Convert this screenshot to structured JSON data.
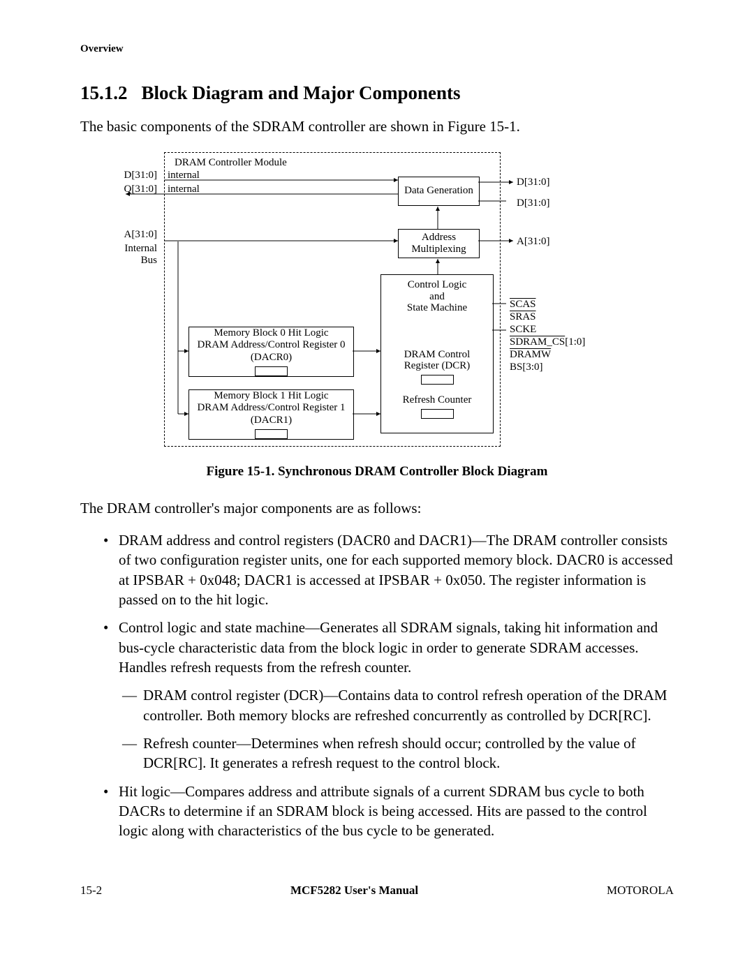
{
  "header": "Overview",
  "section_number": "15.1.2",
  "section_title": "Block Diagram and Major Components",
  "intro": "The basic components of the SDRAM controller are shown in Figure 15-1.",
  "figure_caption": "Figure 15-1. Synchronous DRAM Controller Block Diagram",
  "lead": "The DRAM controller's major components are as follows:",
  "bullets": [
    {
      "text": "DRAM address and control registers (DACR0 and DACR1)—The DRAM controller consists of two configuration register units, one for each supported memory block. DACR0 is accessed at IPSBAR + 0x048; DACR1 is accessed at IPSBAR + 0x050. The register information is passed on to the hit logic."
    },
    {
      "text": "Control logic and state machine—Generates all SDRAM signals, taking hit information and bus-cycle characteristic data from the block logic in order to generate SDRAM accesses. Handles refresh requests from the refresh counter.",
      "sub": [
        "DRAM control register (DCR)—Contains data to control refresh operation of the DRAM controller. Both memory blocks are refreshed concurrently as controlled by DCR[RC].",
        "Refresh counter—Determines when refresh should occur; controlled by the value of DCR[RC]. It generates a refresh request to the control block."
      ]
    },
    {
      "text": "Hit logic—Compares address and attribute signals of a current SDRAM bus cycle to both DACRs to determine if an SDRAM block is being accessed. Hits are passed to the control logic along with characteristics of the bus cycle to be generated."
    }
  ],
  "footer": {
    "left": "15-2",
    "center": "MCF5282 User's Manual",
    "right": "MOTOROLA"
  },
  "diagram": {
    "module_title": "DRAM Controller Module",
    "left_labels": {
      "d": "D[31:0]",
      "d_sub": "internal",
      "q": "Q[31:0]",
      "q_sub": "internal",
      "a": "A[31:0]",
      "bus": "Internal Bus"
    },
    "blocks": {
      "data_gen": "Data Generation",
      "addr_mux": "Address Multiplexing",
      "control": "Control Logic and State Machine",
      "mem0_l1": "Memory Block 0 Hit Logic",
      "mem0_l2": "DRAM Address/Control Register 0",
      "mem0_l3": "(DACR0)",
      "mem1_l1": "Memory Block 1 Hit Logic",
      "mem1_l2": "DRAM Address/Control Register 1",
      "mem1_l3": "(DACR1)",
      "dcr": "DRAM Control Register (DCR)",
      "refresh": "Refresh Counter"
    },
    "right_labels": {
      "d1": "D[31:0]",
      "d2": "D[31:0]",
      "a": "A[31:0]",
      "scas": "SCAS",
      "sras": "SRAS",
      "scke": "SCKE",
      "sdram_cs": "SDRAM_CS[1:0]",
      "dramw": "DRAMW",
      "bs": "BS[3:0]"
    }
  }
}
